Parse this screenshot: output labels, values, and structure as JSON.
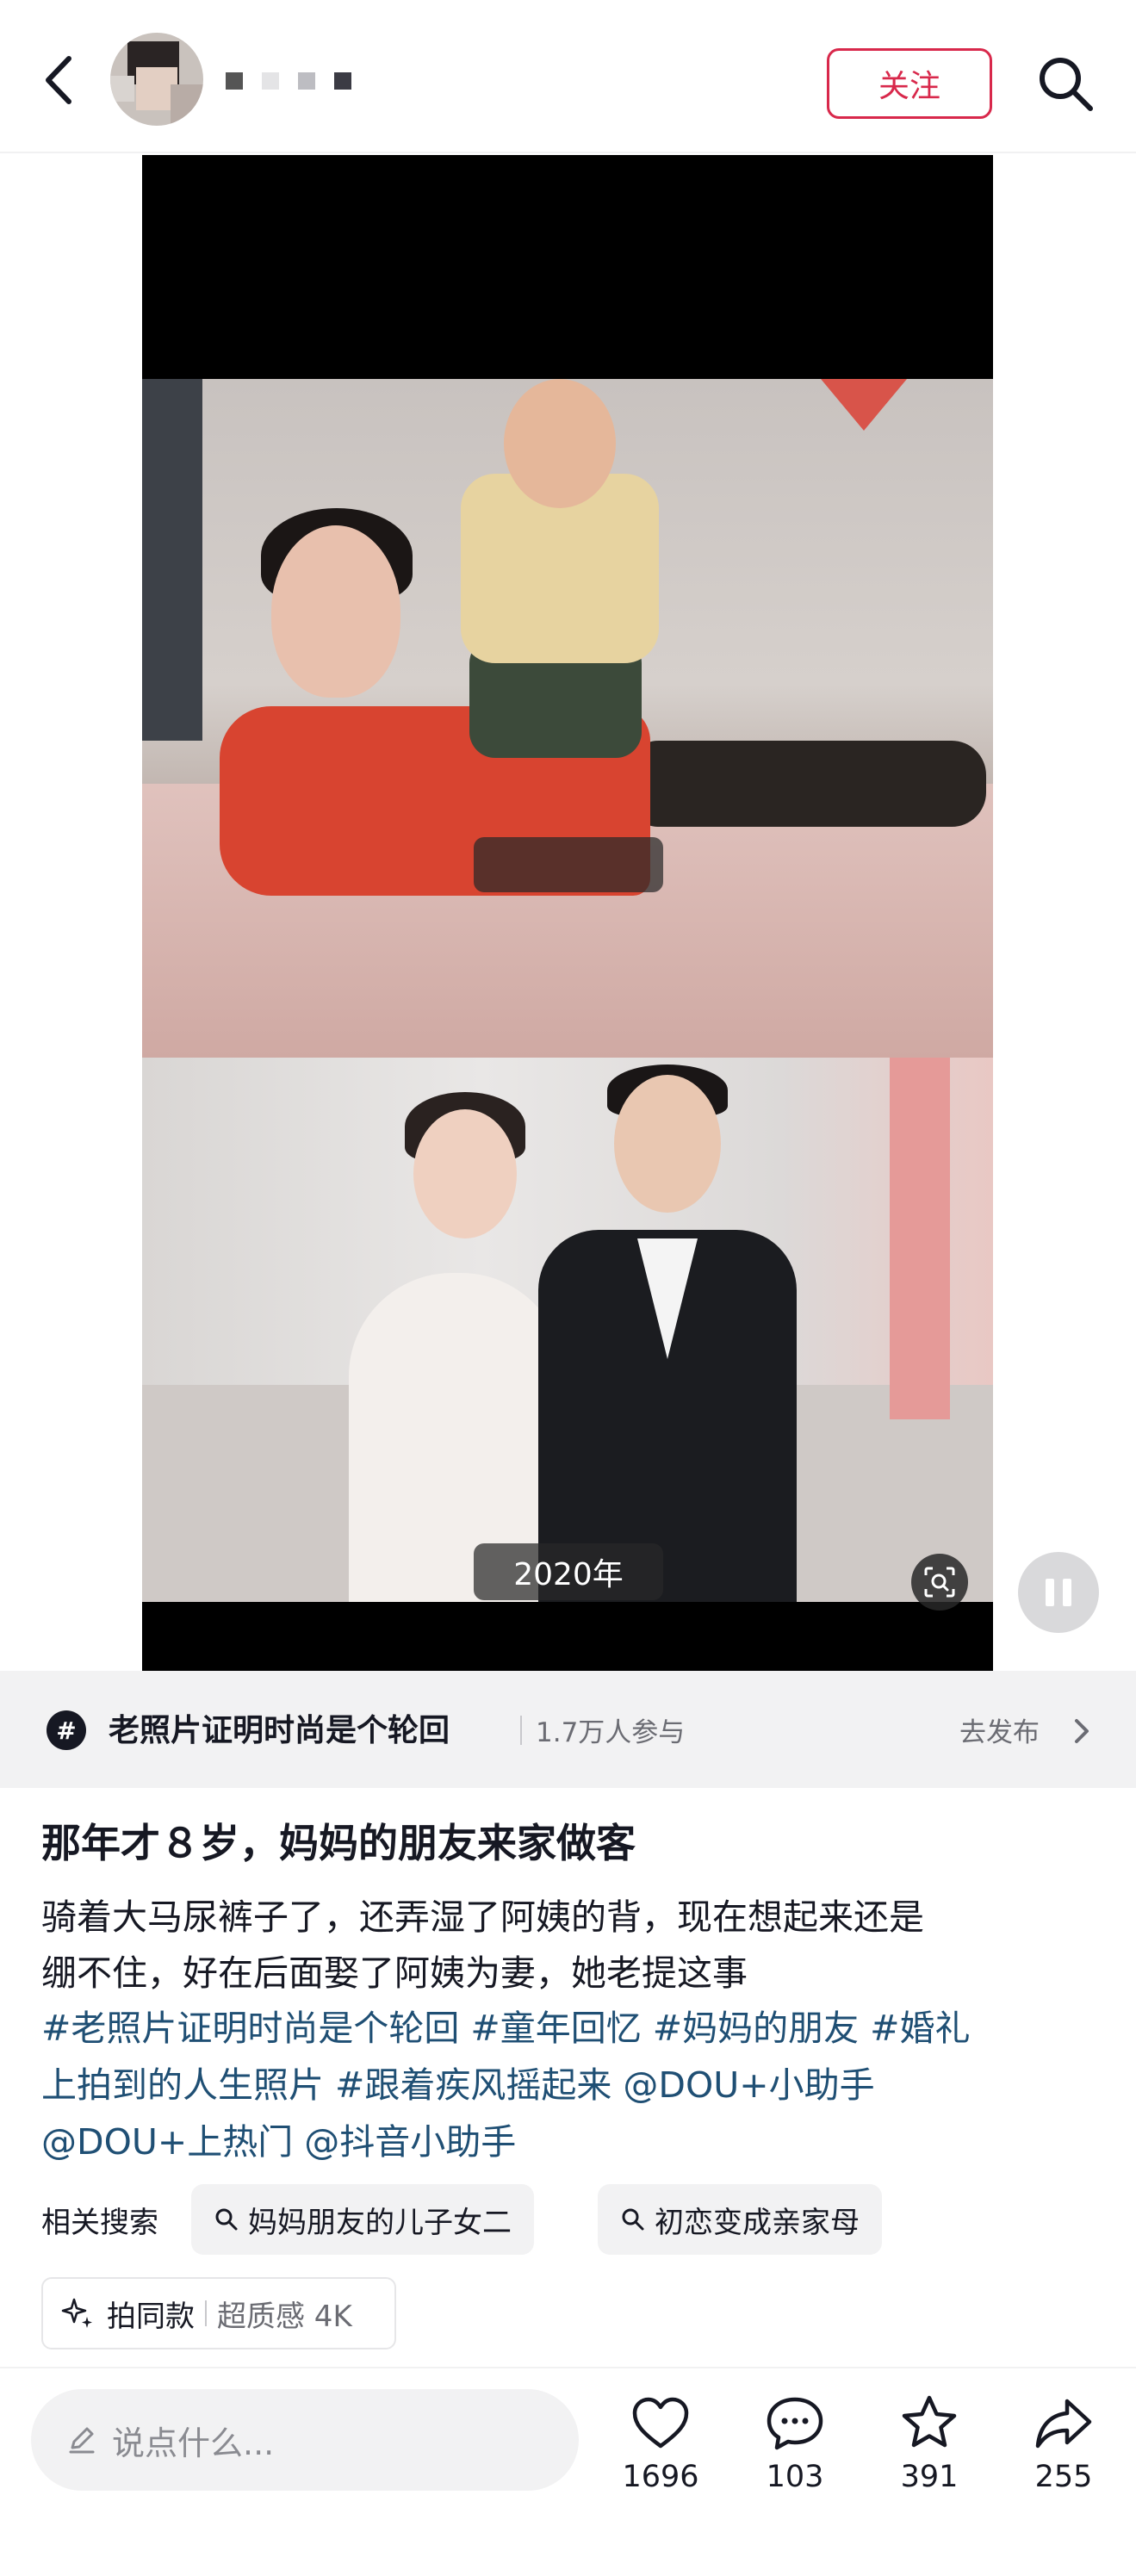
{
  "header": {
    "follow_label": "关注"
  },
  "media": {
    "caption_bottom": "2020年"
  },
  "topic": {
    "title": "老照片证明时尚是个轮回",
    "participants": "1.7万人参与",
    "action": "去发布"
  },
  "post": {
    "title": "那年才８岁，妈妈的朋友来家做客",
    "description_lines": [
      "骑着大马尿裤子了，还弄湿了阿姨的背，现在想起来还是",
      "绷不住，好在后面娶了阿姨为妻，她老提这事"
    ],
    "tag_lines": [
      "#老照片证明时尚是个轮回 #童年回忆 #妈妈的朋友 #婚礼",
      "上拍到的人生照片 #跟着疾风摇起来 @DOU+小助手",
      "@DOU+上热门 @抖音小助手"
    ]
  },
  "related": {
    "label": "相关搜索",
    "items": [
      "妈妈朋友的儿子女二",
      "初恋变成亲家母"
    ]
  },
  "template": {
    "label": "拍同款",
    "quality": "超质感 4K"
  },
  "bottom_bar": {
    "comment_placeholder": "说点什么...",
    "likes": "1696",
    "comments": "103",
    "favorites": "391",
    "shares": "255"
  },
  "colors": {
    "accent": "#d8284b",
    "tag_blue": "#1f4f74",
    "text": "#161823",
    "muted": "#6b6c73"
  }
}
